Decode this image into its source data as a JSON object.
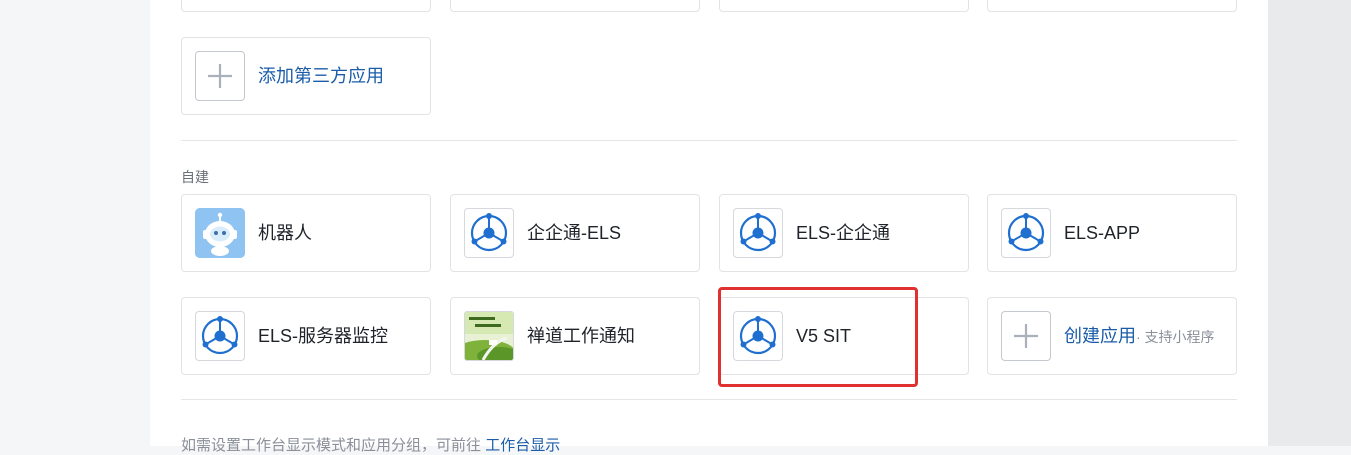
{
  "third_party": {
    "add_label": "添加第三方应用"
  },
  "self_built": {
    "section_title": "自建",
    "apps": [
      {
        "label": "机器人",
        "icon": "robot-icon"
      },
      {
        "label": "企企通-ELS",
        "icon": "els-logo-icon"
      },
      {
        "label": "ELS-企企通",
        "icon": "els-logo-icon"
      },
      {
        "label": "ELS-APP",
        "icon": "els-logo-icon"
      },
      {
        "label": "ELS-服务器监控",
        "icon": "els-logo-icon"
      },
      {
        "label": "禅道工作通知",
        "icon": "zentao-photo-icon"
      },
      {
        "label": "V5 SIT",
        "icon": "els-logo-icon"
      }
    ],
    "create_label": "创建应用",
    "create_sub": "· 支持小程序"
  },
  "footer": {
    "text": "如需设置工作台显示模式和应用分组，可前往",
    "link": "工作台显示"
  },
  "colors": {
    "accent": "#1a5caa",
    "highlight": "#e03030",
    "logo_blue": "#1f6fd0"
  }
}
